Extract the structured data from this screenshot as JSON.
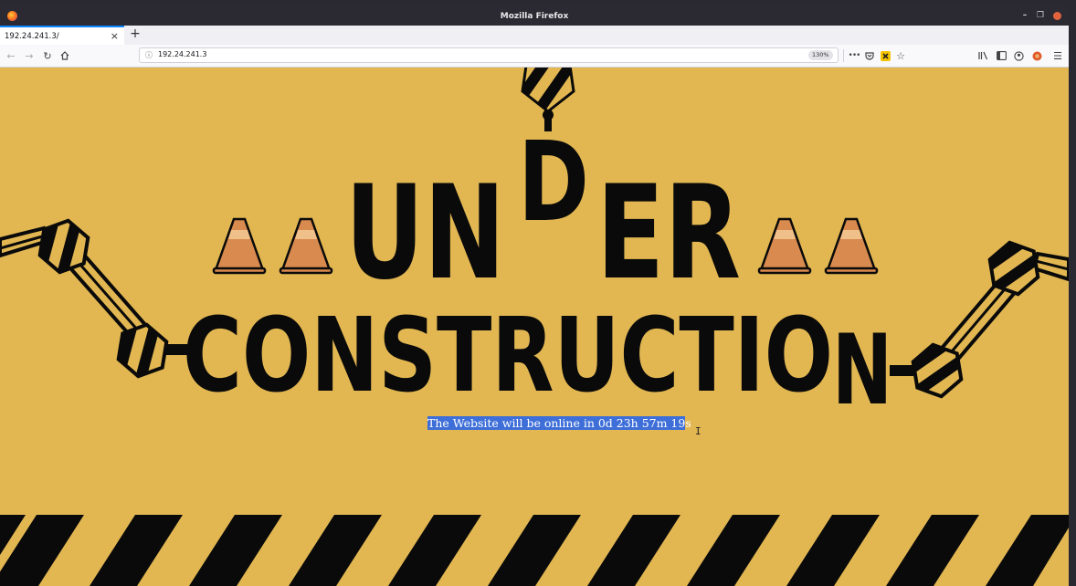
{
  "window": {
    "title": "Mozilla Firefox"
  },
  "tabs": [
    {
      "label": "192.24.241.3/"
    }
  ],
  "navbar": {
    "url": "192.24.241.3",
    "zoom": "130%",
    "more": "•••"
  },
  "page": {
    "heading_line1_left": "UN",
    "heading_line1_raised": "D",
    "heading_line1_right": "ER",
    "heading_line2_main": "CONSTRUCTIO",
    "heading_line2_dropped": "N",
    "countdown_selected": "The Website will be online in 0d 23h 57m 19",
    "countdown_rest": "s"
  },
  "colors": {
    "background": "#e2b752",
    "ink": "#0a0a0a",
    "cone": "#d98a4e",
    "selection": "#3e6fd8"
  }
}
